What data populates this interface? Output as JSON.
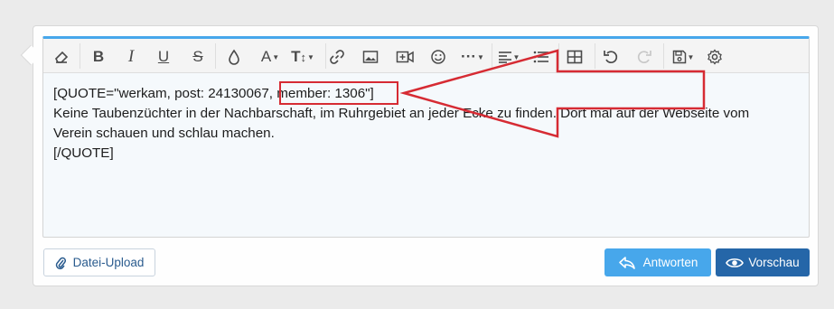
{
  "editor": {
    "content_lines": [
      "[QUOTE=\"werkam, post: 24130067, member: 1306\"]",
      "Keine Taubenzüchter in der Nachbarschaft, im Ruhrgebiet an jeder Ecke zu finden. Dort mal auf der Webseite vom",
      "Verein schauen und schlau machen.",
      "[/QUOTE]"
    ]
  },
  "toolbar": {
    "icons": [
      "eraser-icon",
      "bold-icon",
      "italic-icon",
      "underline-icon",
      "strikethrough-icon",
      "color-drop-icon",
      "font-family-icon",
      "font-size-icon",
      "link-icon",
      "image-icon",
      "media-icon",
      "smilie-icon",
      "more-icon",
      "align-icon",
      "list-icon",
      "table-icon",
      "undo-icon",
      "redo-icon",
      "drafts-icon",
      "settings-icon"
    ]
  },
  "buttons": {
    "upload_label": "Datei-Upload",
    "reply_label": "Antworten",
    "preview_label": "Vorschau"
  },
  "colors": {
    "accent": "#47a7eb",
    "primary": "#2566a8",
    "annotation": "#d62b33"
  }
}
